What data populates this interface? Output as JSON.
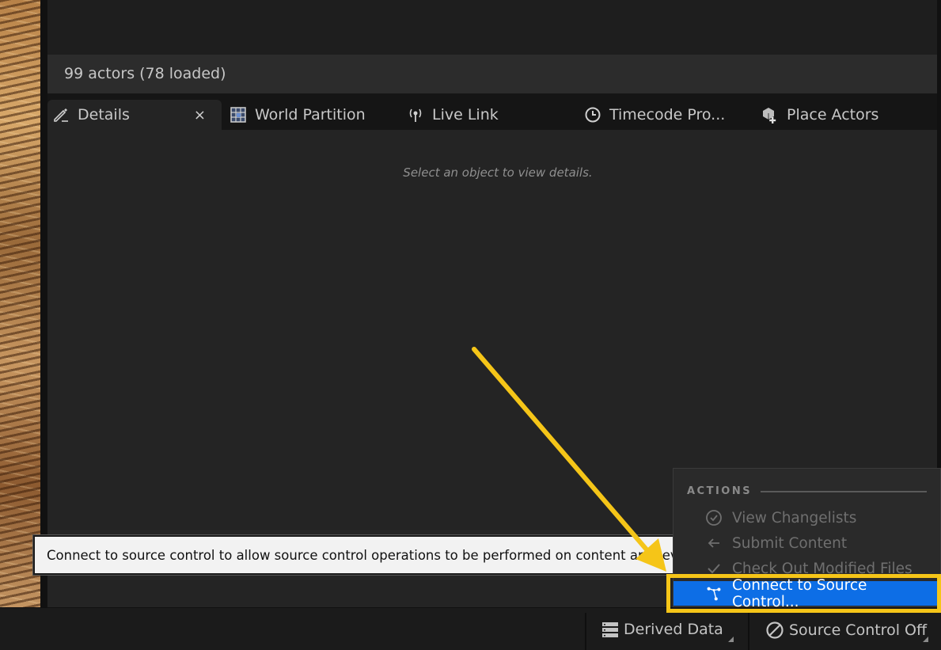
{
  "outliner": {
    "actor_count": "99 actors (78 loaded)"
  },
  "tabs": [
    {
      "label": "Details",
      "icon": "pencil-icon",
      "close": "×"
    },
    {
      "label": "World Partition",
      "icon": "grid-icon"
    },
    {
      "label": "Live Link",
      "icon": "broadcast-icon"
    },
    {
      "label": "Timecode Pro...",
      "icon": "clock-icon"
    },
    {
      "label": "Place Actors",
      "icon": "cube-add-icon"
    }
  ],
  "details": {
    "empty_message": "Select an object to view details."
  },
  "tooltip": {
    "text": "Connect to source control to allow source control operations to be performed on content and levels"
  },
  "source_control_menu": {
    "heading": "ACTIONS",
    "items": [
      {
        "label": "View Changelists",
        "icon": "check-circle-icon",
        "enabled": false
      },
      {
        "label": "Submit Content",
        "icon": "arrow-left-icon",
        "enabled": false
      },
      {
        "label": "Check Out Modified Files",
        "icon": "checkmark-icon",
        "enabled": false
      },
      {
        "label": "Connect to Source Control...",
        "icon": "branch-icon",
        "enabled": true,
        "highlighted": true
      }
    ]
  },
  "status_bar": {
    "derived_data": "Derived Data",
    "source_control": "Source Control Off"
  },
  "colors": {
    "highlight": "#0d6ee6",
    "annotation": "#f5c518"
  }
}
